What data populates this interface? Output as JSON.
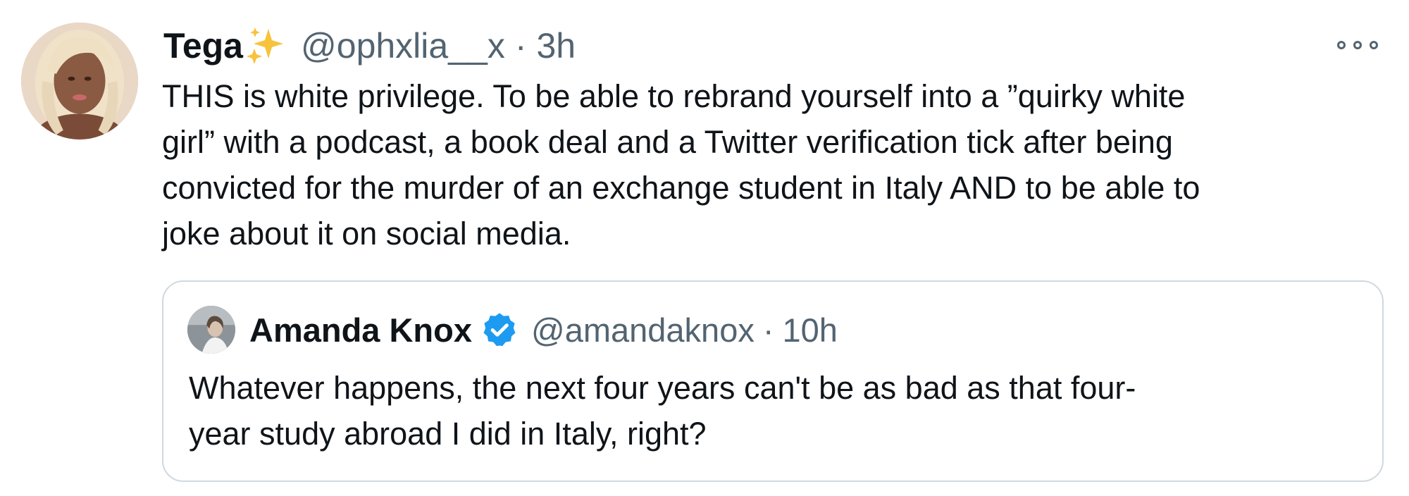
{
  "tweet": {
    "display_name": "Tega",
    "name_emoji_icon": "sparkles-icon",
    "handle": "@ophxlia__x",
    "separator": "·",
    "time": "3h",
    "more_icon": "more-horizontal-icon",
    "text_lines": [
      "THIS is white privilege. To be able to rebrand yourself into a ”quirky white",
      "girl” with a podcast, a book deal and a Twitter verification tick after being",
      "convicted for the murder of an exchange student in Italy AND to be able to",
      "joke about it on social media."
    ]
  },
  "quoted_tweet": {
    "display_name": "Amanda Knox",
    "verified_icon": "verified-badge-icon",
    "handle": "@amandaknox",
    "separator": "·",
    "time": "10h",
    "text_lines": [
      "Whatever happens, the next four years can't be as bad as that four-",
      "year study abroad I did in Italy, right?"
    ]
  },
  "colors": {
    "text_primary": "#0f1419",
    "text_secondary": "#536471",
    "card_border": "#cfd9de",
    "verified_blue": "#1d9bf0",
    "sparkle_gold": "#f7c33c"
  }
}
